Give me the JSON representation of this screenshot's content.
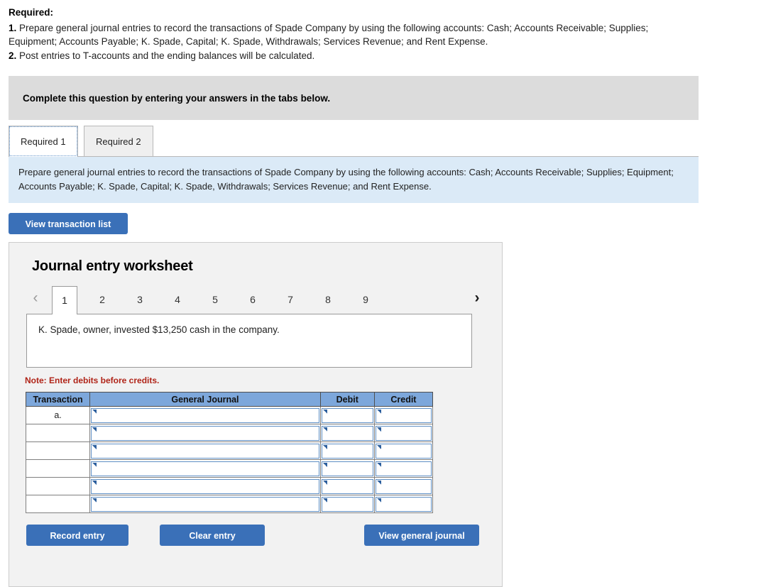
{
  "required": {
    "title": "Required:",
    "items": [
      {
        "num": "1.",
        "text": " Prepare general journal entries to record the transactions of Spade Company by using the following accounts: Cash; Accounts Receivable; Supplies; Equipment; Accounts Payable; K. Spade, Capital; K. Spade, Withdrawals; Services Revenue; and Rent Expense."
      },
      {
        "num": "2.",
        "text": " Post entries to T-accounts and the ending balances will be calculated."
      }
    ]
  },
  "banner": {
    "text": "Complete this question by entering your answers in the tabs below."
  },
  "tabs": {
    "active": "Required 1",
    "inactive": "Required 2"
  },
  "requirement_description": "Prepare general journal entries to record the transactions of Spade Company by using the following accounts: Cash; Accounts Receivable; Supplies; Equipment; Accounts Payable; K. Spade, Capital; K. Spade, Withdrawals; Services Revenue; and Rent Expense.",
  "toolbar": {
    "view_transaction_list": "View transaction list"
  },
  "worksheet": {
    "title": "Journal entry worksheet",
    "pager": {
      "prev_icon": "chevron-left-icon",
      "next_icon": "chevron-right-icon",
      "pages": [
        "1",
        "2",
        "3",
        "4",
        "5",
        "6",
        "7",
        "8",
        "9"
      ],
      "active_page": "1"
    },
    "transaction_text": "K. Spade, owner, invested $13,250 cash in the company.",
    "note": "Note: Enter debits before credits.",
    "table": {
      "headers": [
        "Transaction",
        "General Journal",
        "Debit",
        "Credit"
      ],
      "rows": [
        {
          "transaction": "a.",
          "general_journal": "",
          "debit": "",
          "credit": ""
        },
        {
          "transaction": "",
          "general_journal": "",
          "debit": "",
          "credit": ""
        },
        {
          "transaction": "",
          "general_journal": "",
          "debit": "",
          "credit": ""
        },
        {
          "transaction": "",
          "general_journal": "",
          "debit": "",
          "credit": ""
        },
        {
          "transaction": "",
          "general_journal": "",
          "debit": "",
          "credit": ""
        },
        {
          "transaction": "",
          "general_journal": "",
          "debit": "",
          "credit": ""
        }
      ]
    },
    "buttons": {
      "record": "Record entry",
      "clear": "Clear entry",
      "view_general_journal": "View general journal"
    }
  },
  "colors": {
    "button_blue": "#3a70b8",
    "table_header_blue": "#7da7db",
    "info_panel_blue": "#dbeaf7",
    "banner_gray": "#dcdcdc",
    "panel_gray": "#f2f2f2",
    "note_red": "#b02418"
  }
}
